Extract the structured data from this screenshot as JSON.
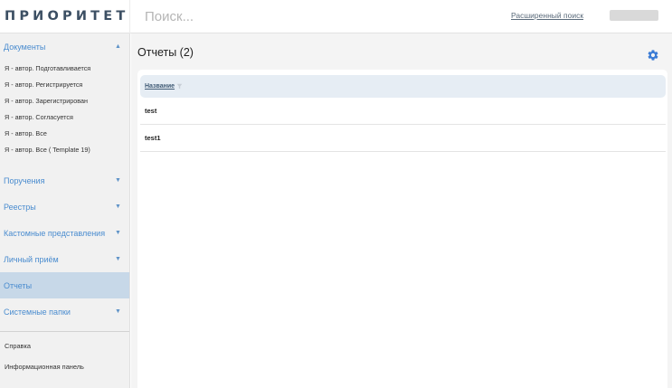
{
  "header": {
    "logo": "ПРИОРИТЕТ",
    "search_placeholder": "Поиск...",
    "advanced_search": "Расширенный поиск"
  },
  "sidebar": {
    "documents": {
      "label": "Документы",
      "items": [
        "Я - автор. Подготавливается",
        "Я - автор. Регистрируется",
        "Я - автор. Зарегистрирован",
        "Я - автор. Согласуется",
        "Я - автор. Все",
        "Я - автор. Все ( Template 19)"
      ]
    },
    "sections": [
      "Поручения",
      "Реестры",
      "Кастомные представления",
      "Личный приём"
    ],
    "reports": "Отчеты",
    "system_folders": "Системные папки",
    "help": "Справка",
    "dashboard": "Информационная панель"
  },
  "main": {
    "title": "Отчеты (2)",
    "column_header": "Название",
    "rows": [
      "test",
      "test1"
    ]
  },
  "colors": {
    "accent": "#4a8ccf",
    "active_bg": "#c7d8e8",
    "header_row_bg": "#e6edf4",
    "logo": "#3c4f63"
  },
  "icons": {
    "settings": "gear-icon",
    "collapse": "chevron-up-icon",
    "expand": "chevron-down-icon",
    "filter": "filter-icon"
  }
}
